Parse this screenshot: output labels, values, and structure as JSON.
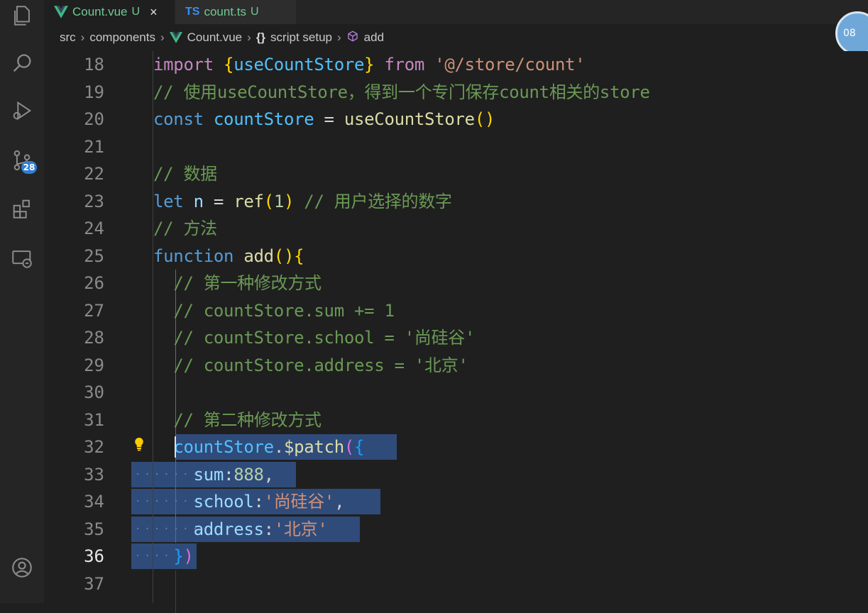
{
  "tabs": [
    {
      "name": "Count.vue",
      "status": "U",
      "close": "×",
      "active": true
    },
    {
      "name": "count.ts",
      "status": "U",
      "icon": "TS",
      "active": false
    }
  ],
  "breadcrumb": {
    "items": [
      "src",
      "components",
      "Count.vue",
      "script setup",
      "add"
    ],
    "brace_icon": "{}"
  },
  "avatar_text": "08",
  "activity": {
    "icons": [
      "explorer-icon",
      "search-icon",
      "run-debug-icon",
      "source-control-icon",
      "extensions-icon",
      "remote-explorer-icon",
      "account-icon"
    ],
    "scm_badge": "28"
  },
  "editor": {
    "current_line": 36,
    "lines": [
      {
        "n": "18",
        "t": [
          [
            "kw2",
            "import "
          ],
          [
            "br1",
            "{"
          ],
          [
            "var",
            "useCountStore"
          ],
          [
            "br1",
            "}"
          ],
          [
            "kw2",
            " from "
          ],
          [
            "str",
            "'@/store/count'"
          ]
        ]
      },
      {
        "n": "19",
        "t": [
          [
            "cm",
            "// 使用useCountStore，得到一个专门保存count相关的store"
          ]
        ]
      },
      {
        "n": "20",
        "t": [
          [
            "kw",
            "const "
          ],
          [
            "var",
            "countStore"
          ],
          [
            "plain",
            " = "
          ],
          [
            "fn",
            "useCountStore"
          ],
          [
            "br1",
            "()"
          ]
        ]
      },
      {
        "n": "21",
        "t": []
      },
      {
        "n": "22",
        "t": [
          [
            "cm",
            "// 数据"
          ]
        ]
      },
      {
        "n": "23",
        "t": [
          [
            "kw",
            "let "
          ],
          [
            "prop",
            "n"
          ],
          [
            "plain",
            " = "
          ],
          [
            "fn",
            "ref"
          ],
          [
            "br1",
            "("
          ],
          [
            "num",
            "1"
          ],
          [
            "br1",
            ")"
          ],
          [
            "cm",
            " // 用户选择的数字"
          ]
        ]
      },
      {
        "n": "24",
        "t": [
          [
            "cm",
            "// 方法"
          ]
        ]
      },
      {
        "n": "25",
        "t": [
          [
            "kw",
            "function "
          ],
          [
            "fn",
            "add"
          ],
          [
            "br1",
            "(){"
          ]
        ]
      },
      {
        "n": "26",
        "t": [
          [
            "plain",
            "  "
          ],
          [
            "cm",
            "// 第一种修改方式"
          ]
        ]
      },
      {
        "n": "27",
        "t": [
          [
            "plain",
            "  "
          ],
          [
            "cm",
            "// countStore.sum += 1"
          ]
        ]
      },
      {
        "n": "28",
        "t": [
          [
            "plain",
            "  "
          ],
          [
            "cm",
            "// countStore.school = '尚硅谷'"
          ]
        ]
      },
      {
        "n": "29",
        "t": [
          [
            "plain",
            "  "
          ],
          [
            "cm",
            "// countStore.address = '北京'"
          ]
        ]
      },
      {
        "n": "30",
        "t": []
      },
      {
        "n": "31",
        "t": [
          [
            "plain",
            "  "
          ],
          [
            "cm",
            "// 第二种修改方式"
          ]
        ]
      },
      {
        "n": "32",
        "t": [
          [
            "plain",
            "  "
          ],
          [
            "var",
            "countStore"
          ],
          [
            "plain",
            "."
          ],
          [
            "fn",
            "$patch"
          ],
          [
            "br2",
            "("
          ],
          [
            "br3",
            "{"
          ]
        ]
      },
      {
        "n": "33",
        "t": [
          [
            "plain",
            "    "
          ],
          [
            "prop",
            "sum"
          ],
          [
            "plain",
            ":"
          ],
          [
            "num",
            "888"
          ],
          [
            "plain",
            ","
          ]
        ]
      },
      {
        "n": "34",
        "t": [
          [
            "plain",
            "    "
          ],
          [
            "prop",
            "school"
          ],
          [
            "plain",
            ":"
          ],
          [
            "str",
            "'尚硅谷'"
          ],
          [
            "plain",
            ","
          ]
        ]
      },
      {
        "n": "35",
        "t": [
          [
            "plain",
            "    "
          ],
          [
            "prop",
            "address"
          ],
          [
            "plain",
            ":"
          ],
          [
            "str",
            "'北京'"
          ]
        ]
      },
      {
        "n": "36",
        "t": [
          [
            "plain",
            "  "
          ],
          [
            "br3",
            "}"
          ],
          [
            "br2",
            ")"
          ]
        ]
      },
      {
        "n": "37",
        "t": []
      }
    ]
  }
}
